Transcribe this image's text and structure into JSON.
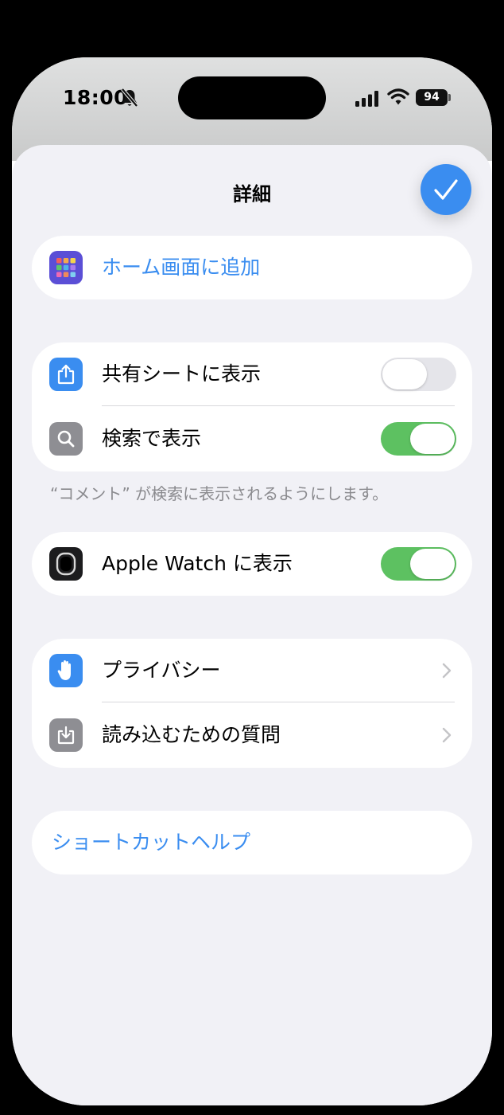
{
  "status_bar": {
    "time": "18:00",
    "battery": "94"
  },
  "sheet": {
    "title": "詳細"
  },
  "add_to_home": {
    "label": "ホーム画面に追加"
  },
  "sharing": {
    "items": [
      {
        "label": "共有シートに表示",
        "toggle": "off"
      },
      {
        "label": "検索で表示",
        "toggle": "on"
      }
    ],
    "footnote": "“コメント” が検索に表示されるようにします。"
  },
  "watch": {
    "label": "Apple Watch に表示",
    "toggle": "on"
  },
  "info": {
    "items": [
      {
        "label": "プライバシー"
      },
      {
        "label": "読み込むための質問"
      }
    ]
  },
  "help": {
    "label": "ショートカットヘルプ"
  },
  "colors": {
    "accent": "#3a8df0",
    "toggle_on": "#5dc161",
    "sheet_background": "#f1f1f6"
  }
}
